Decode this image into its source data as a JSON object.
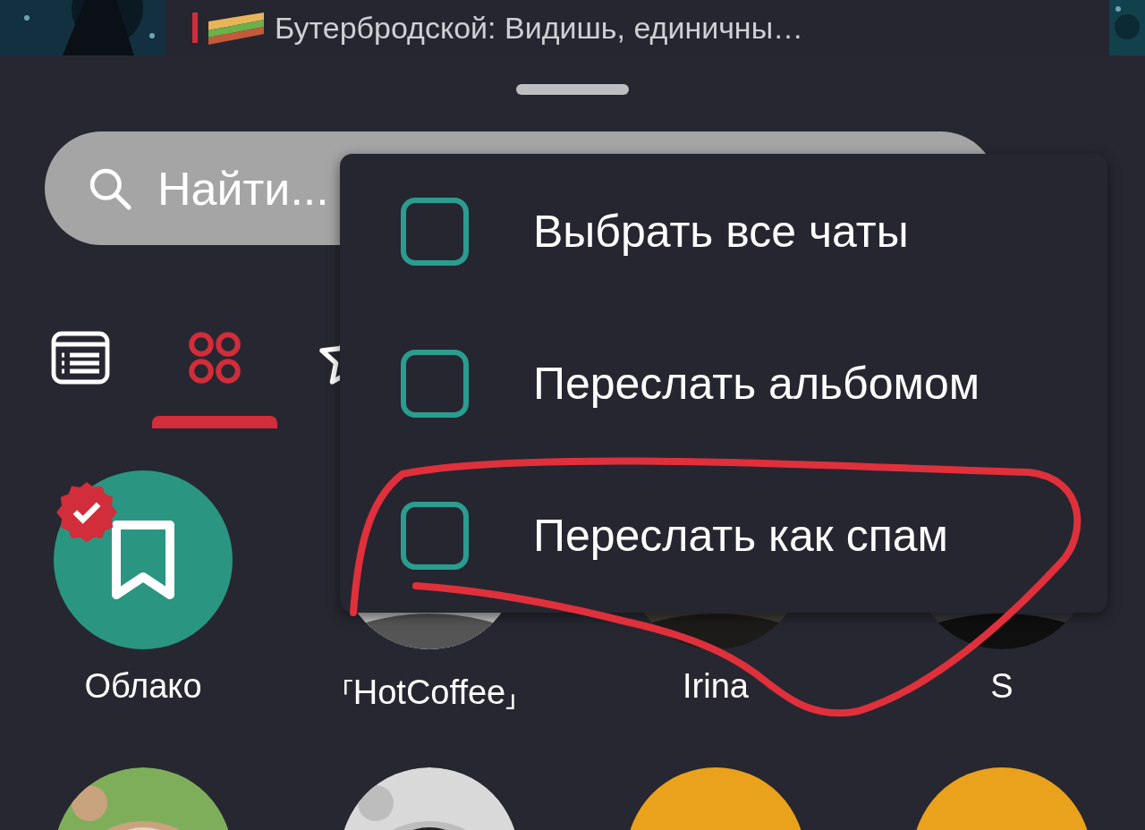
{
  "chat_preview": {
    "text": "Бутербродской: Видишь, единичны…"
  },
  "search": {
    "placeholder": "Найти..."
  },
  "tabs": [
    {
      "kind": "list",
      "selected": false
    },
    {
      "kind": "grid",
      "selected": true
    },
    {
      "kind": "star",
      "selected": false
    }
  ],
  "chats": [
    {
      "name": "Облако",
      "kind": "saved",
      "verified": true
    },
    {
      "name": "⸢HotCoffee⸥",
      "kind": "picture"
    },
    {
      "name": "Irina",
      "kind": "picture"
    },
    {
      "name": "S",
      "kind": "picture"
    }
  ],
  "more_chats": [
    {
      "kind": "picture"
    },
    {
      "kind": "picture"
    },
    {
      "kind": "yellow"
    },
    {
      "kind": "yellow"
    }
  ],
  "menu": {
    "items": [
      {
        "label": "Выбрать все чаты",
        "checked": false,
        "circled": false
      },
      {
        "label": "Переслать альбомом",
        "checked": false,
        "circled": false
      },
      {
        "label": "Переслать как спам",
        "checked": false,
        "circled": true
      }
    ]
  }
}
